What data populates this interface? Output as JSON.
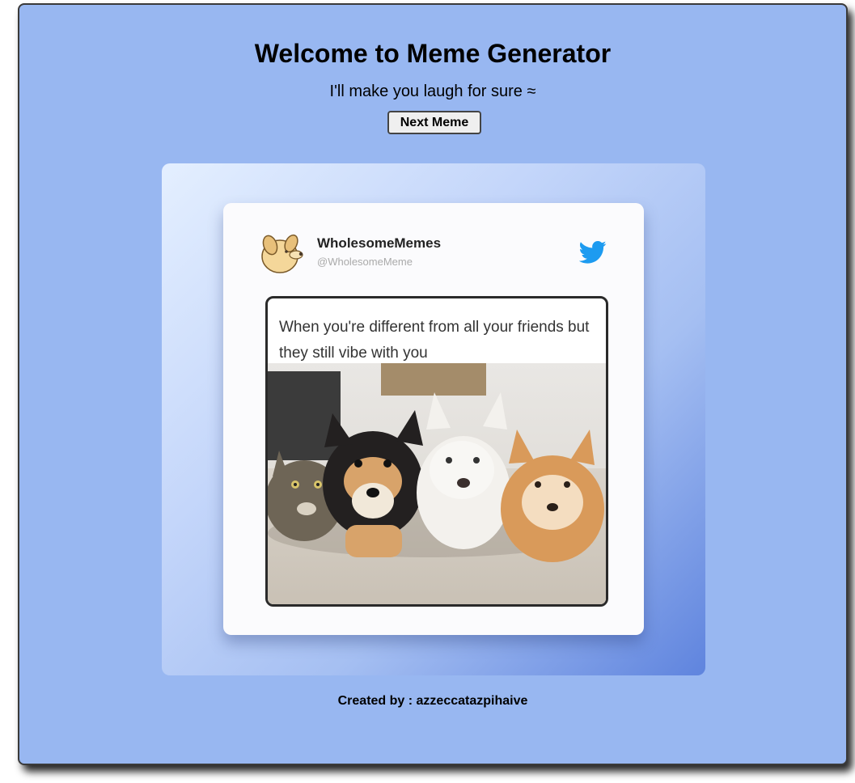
{
  "page": {
    "title": "Welcome to Meme Generator",
    "subtitle": "I'll make you laugh for sure ≈",
    "next_button_label": "Next Meme",
    "credit": "Created by : azzeccatazpihaive"
  },
  "meme": {
    "account_name": "WholesomeMemes",
    "account_handle": "@WholesomeMeme",
    "caption": "When you're different from all your friends but they still vibe with you",
    "platform_icon": "twitter-bird-icon",
    "avatar_icon": "dog-avatar-icon"
  },
  "colors": {
    "background": "#98b7f1",
    "twitter_blue": "#1d9bf0"
  }
}
